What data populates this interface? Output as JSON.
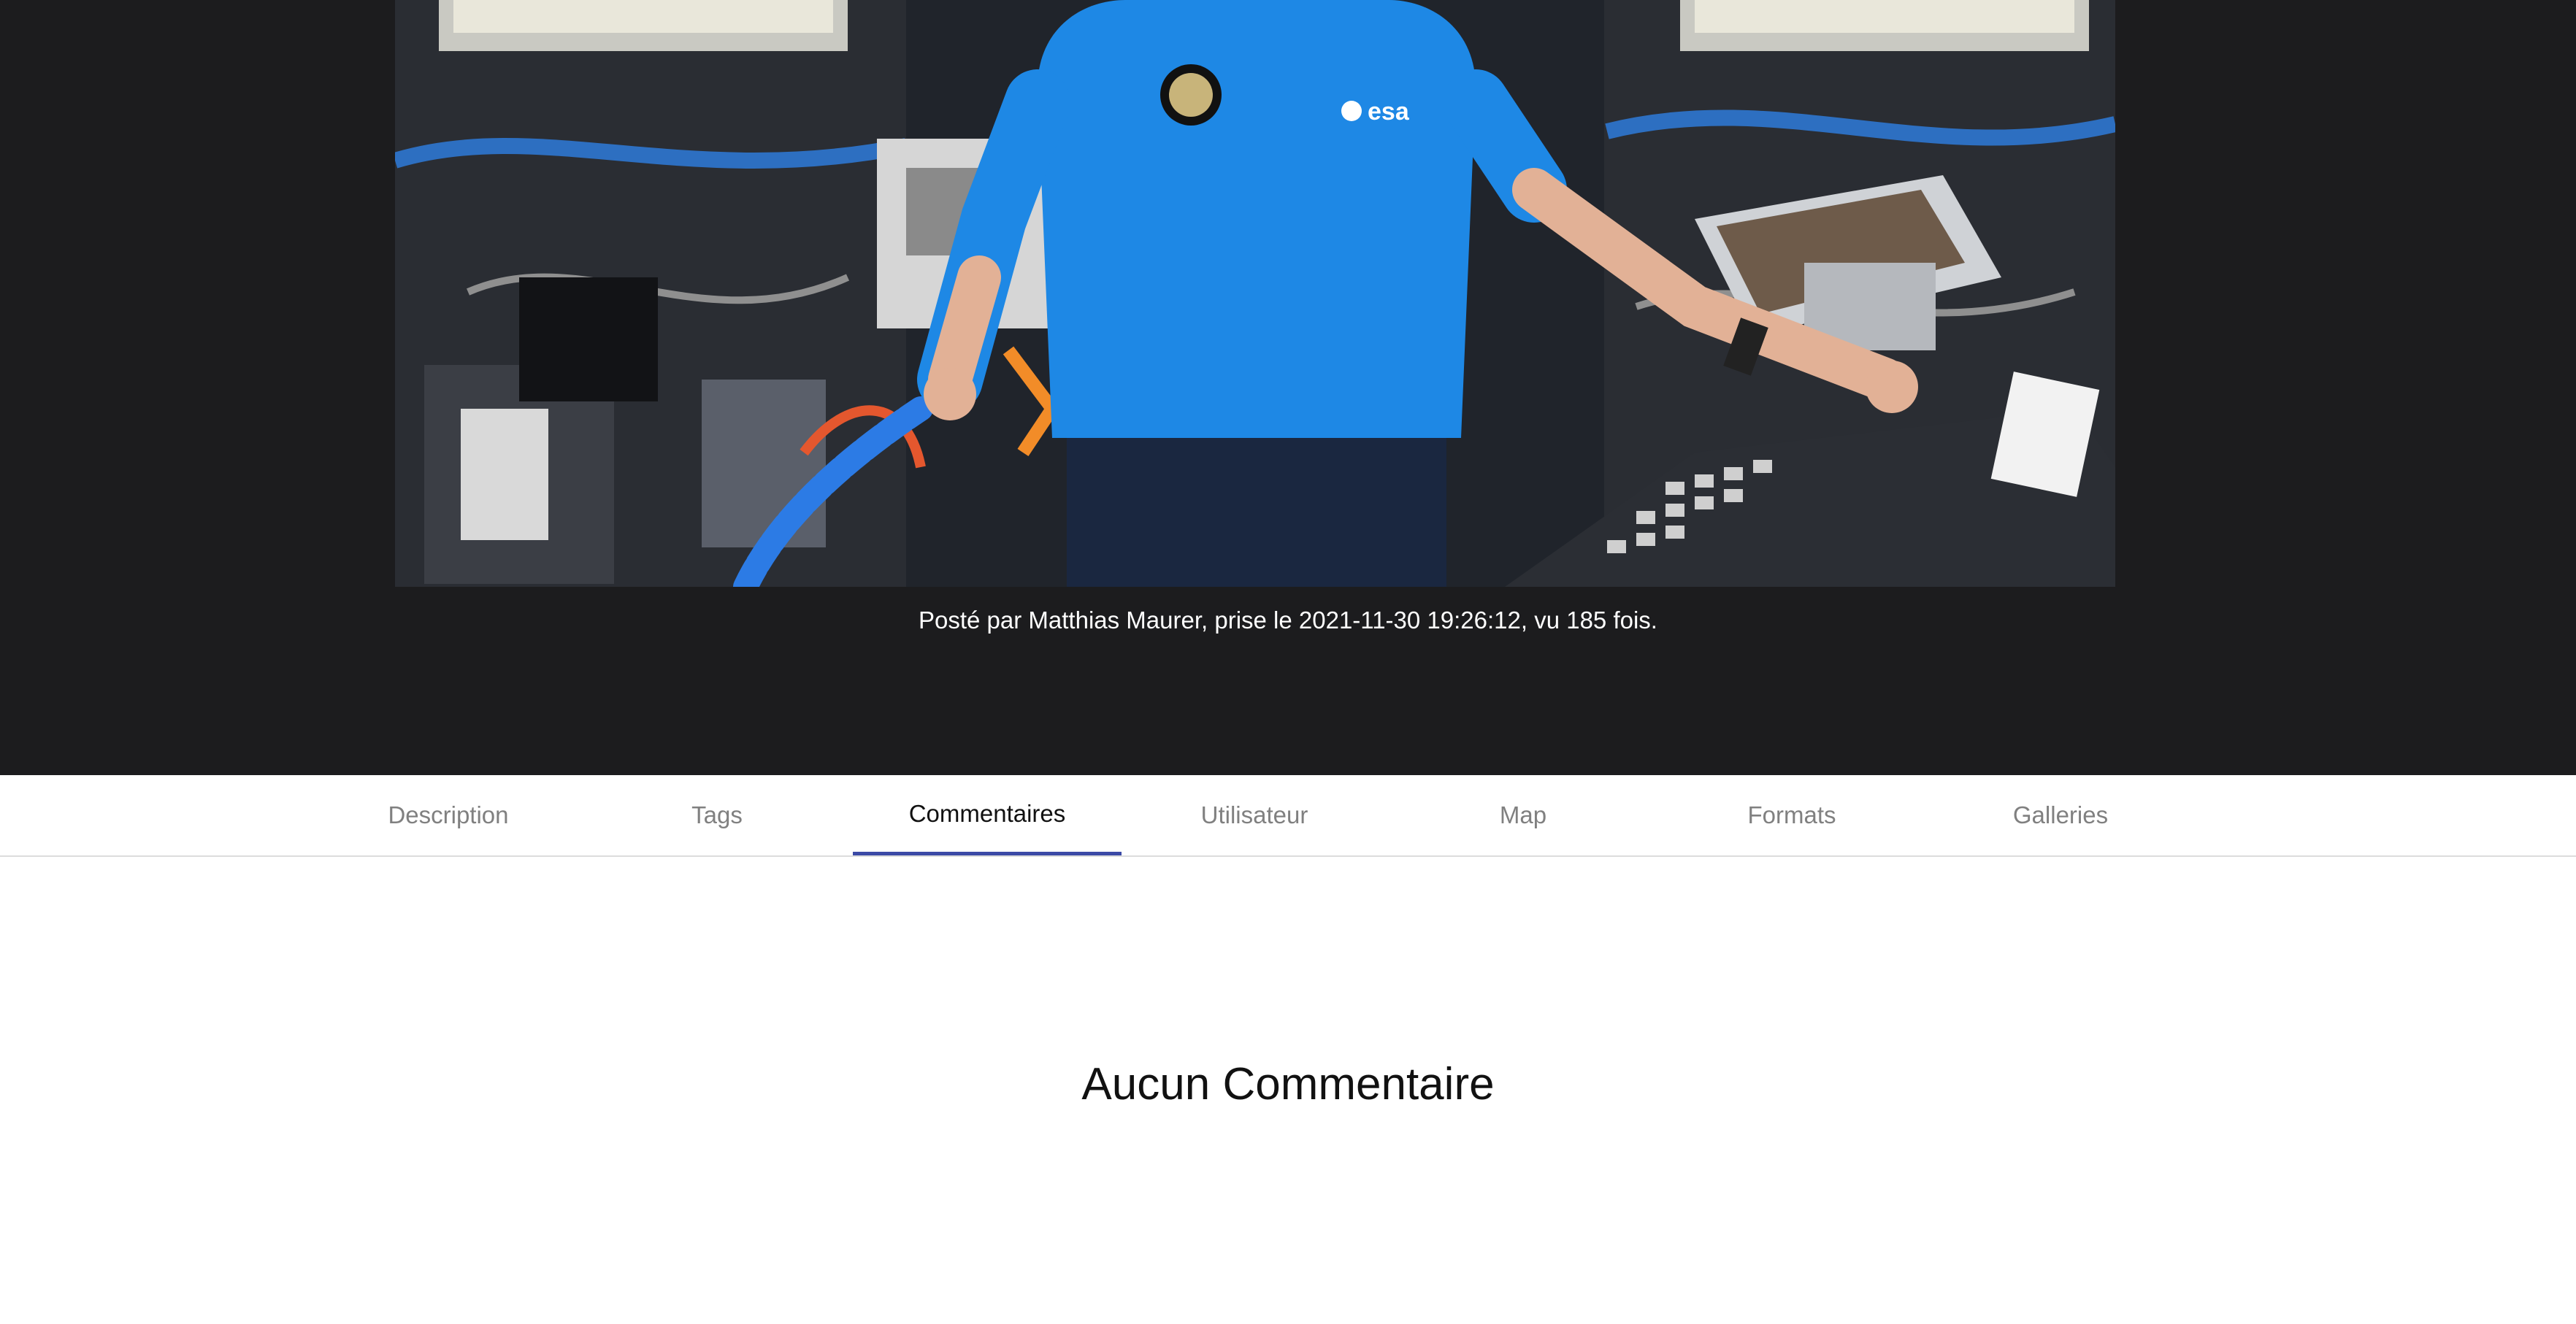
{
  "photo": {
    "badge_text": "esa"
  },
  "caption": "Posté par Matthias Maurer, prise le 2021-11-30 19:26:12, vu 185 fois.",
  "tabs": [
    {
      "label": "Description",
      "active": false
    },
    {
      "label": "Tags",
      "active": false
    },
    {
      "label": "Commentaires",
      "active": true
    },
    {
      "label": "Utilisateur",
      "active": false
    },
    {
      "label": "Map",
      "active": false
    },
    {
      "label": "Formats",
      "active": false
    },
    {
      "label": "Galleries",
      "active": false
    }
  ],
  "comments": {
    "empty_message": "Aucun Commentaire"
  },
  "colors": {
    "hero_background": "#1c1c1e",
    "tab_active_indicator": "#3b4aa6",
    "tab_inactive_text": "#808080",
    "shirt_blue": "#1e88e5"
  }
}
